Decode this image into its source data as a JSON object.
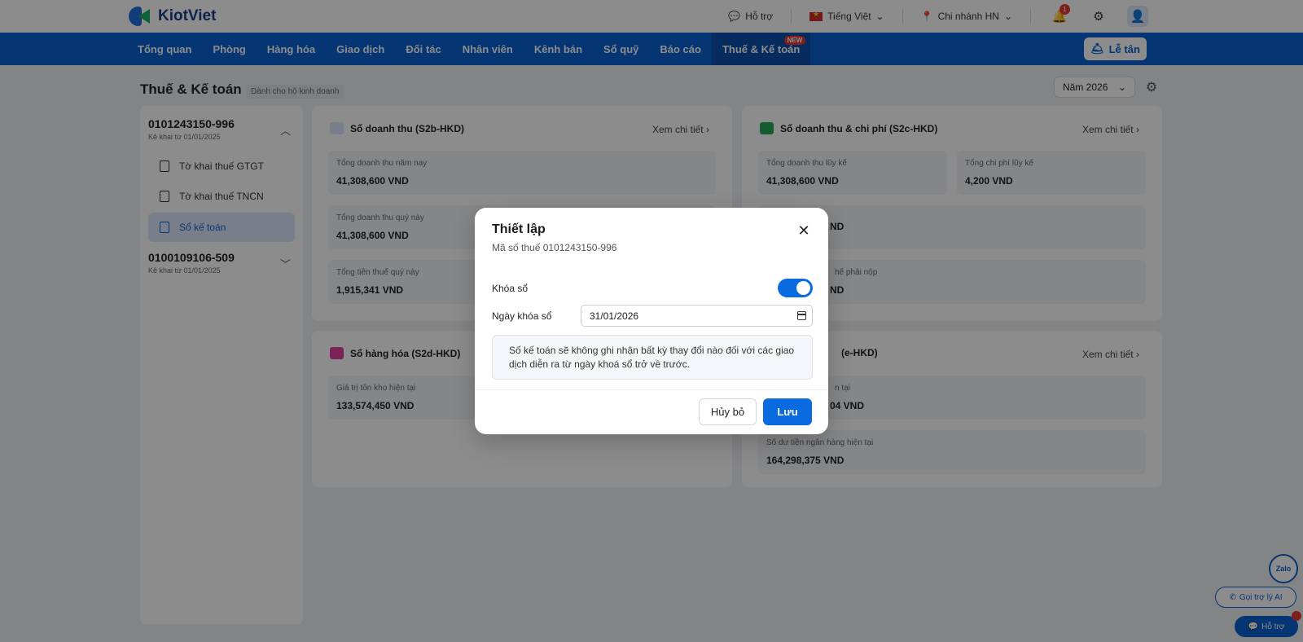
{
  "brand": {
    "name": "KiotViet"
  },
  "topbar": {
    "support": "Hỗ trợ",
    "language": "Tiếng Việt",
    "branch": "Chi nhánh HN",
    "notification_count": "1"
  },
  "nav": {
    "items": [
      "Tổng quan",
      "Phòng",
      "Hàng hóa",
      "Giao dịch",
      "Đối tác",
      "Nhân viên",
      "Kênh bán",
      "Sổ quỹ",
      "Báo cáo",
      "Thuế & Kế toán"
    ],
    "active": "Thuế & Kế toán",
    "new_badge": "NEW",
    "reception": "Lễ tân"
  },
  "page": {
    "title": "Thuế & Kế toán",
    "subtitle": "Dành cho hộ kinh doanh",
    "year": "Năm 2026"
  },
  "sidebar": {
    "accounts": [
      {
        "id": "0101243150-996",
        "since": "Kê khai từ 01/01/2025"
      },
      {
        "id": "0100109106-509",
        "since": "Kê khai từ 01/01/2025"
      }
    ],
    "items": [
      {
        "label": "Tờ khai thuế GTGT"
      },
      {
        "label": "Tờ khai thuế TNCN"
      },
      {
        "label": "Sổ kế toán"
      }
    ]
  },
  "cards": {
    "revenue": {
      "title": "Sổ doanh thu (S2b-HKD)",
      "link": "Xem chi tiết",
      "stats": [
        {
          "label": "Tổng doanh thu năm nay",
          "value": "41,308,600 VND"
        },
        {
          "label": "Tổng doanh thu quý này",
          "value": "41,308,600 VND"
        },
        {
          "label": "Tổng tiền thuế quý này",
          "value": "1,915,341 VND"
        }
      ]
    },
    "revenue_expense": {
      "title": "Sổ doanh thu & chi phí (S2c-HKD)",
      "link": "Xem chi tiết",
      "stats": [
        {
          "label": "Tổng doanh thu lũy kế",
          "value": "41,308,600 VND"
        },
        {
          "label": "Tổng chi phí lũy kế",
          "value": "4,200 VND"
        }
      ],
      "partial_value_1": "ND",
      "partial_label_3": "hế phải nộp",
      "partial_value_3": "ND"
    },
    "goods": {
      "title": "Sổ hàng hóa (S2d-HKD)",
      "stats": [
        {
          "label": "Giá trị tồn kho hiện tại",
          "value": "133,574,450 VND"
        }
      ]
    },
    "cash": {
      "title_partial": "(e-HKD)",
      "link": "Xem chi tiết",
      "partial_label_1": "n tại",
      "partial_value_1": "04 VND",
      "stats": [
        {
          "label": "Số dư tiền ngân hàng hiện tại",
          "value": "164,298,375 VND"
        }
      ]
    }
  },
  "modal": {
    "title": "Thiết lập",
    "tax_code": "Mã số thuế 0101243150-996",
    "lock_label": "Khóa sổ",
    "lock_on": true,
    "date_label": "Ngày khóa sổ",
    "date_value": "31/01/2026",
    "note": "Số kế toán sẽ không ghi nhận bất kỳ thay đổi nào đối với các giao dịch diễn ra từ ngày khoá sổ trở về trước.",
    "cancel": "Hủy bỏ",
    "save": "Lưu"
  },
  "widgets": {
    "zalo": "Zalo",
    "ai": "Gọi trợ lý AI",
    "help": "Hỗ trợ"
  },
  "colors": {
    "primary": "#0a61d1",
    "toggle_on": "#0a6be0",
    "badge": "#e53935"
  }
}
